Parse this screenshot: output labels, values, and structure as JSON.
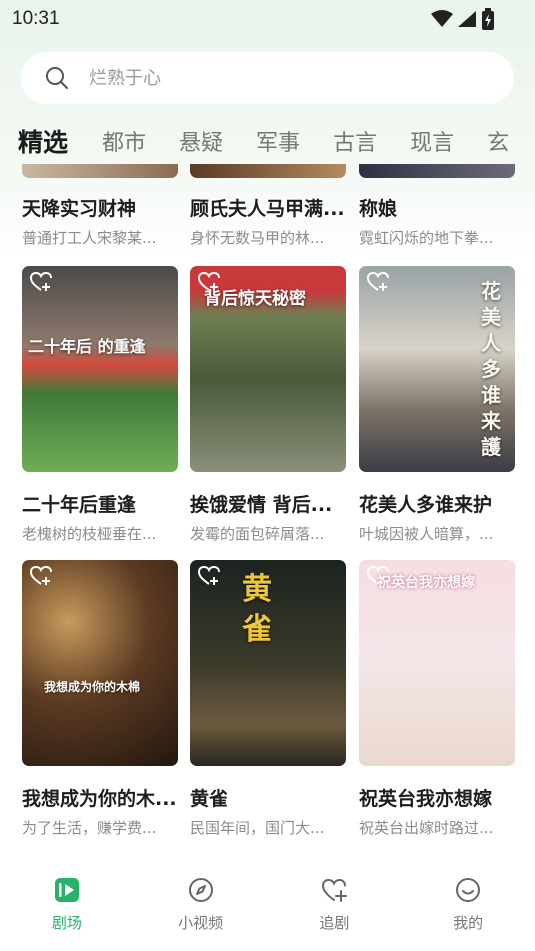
{
  "status": {
    "time": "10:31"
  },
  "search": {
    "placeholder": "烂熟于心"
  },
  "tabs": [
    {
      "label": "精选",
      "active": true
    },
    {
      "label": "都市"
    },
    {
      "label": "悬疑"
    },
    {
      "label": "军事"
    },
    {
      "label": "古言"
    },
    {
      "label": "现言"
    },
    {
      "label": "玄"
    }
  ],
  "dramas": [
    {
      "title": "天降实习财神",
      "desc": "普通打工人宋黎某..."
    },
    {
      "title": "顾氏夫人马甲满...",
      "desc": "身怀无数马甲的林..."
    },
    {
      "title": "称娘",
      "desc": "霓虹闪烁的地下拳..."
    },
    {
      "title": "二十年后重逢",
      "desc": "老槐树的枝桠垂在...",
      "poster_text": "二十年后 的重逢"
    },
    {
      "title": "挨饿爱情 背后...",
      "desc": "发霉的面包碎屑落...",
      "poster_text": "背后惊天秘密"
    },
    {
      "title": "花美人多谁来护",
      "desc": "叶城因被人暗算，...",
      "poster_text": "花美人多谁来護"
    },
    {
      "title": "我想成为你的木...",
      "desc": "为了生活，赚学费...",
      "poster_text": "我想成为你的木棉"
    },
    {
      "title": "黄雀",
      "desc": "民国年间，国门大...",
      "poster_text": "黄雀"
    },
    {
      "title": "祝英台我亦想嫁",
      "desc": "祝英台出嫁时路过...",
      "poster_text": "祝英台我亦想嫁"
    }
  ],
  "nav": [
    {
      "label": "剧场",
      "icon": "theater-play-icon",
      "active": true
    },
    {
      "label": "小视频",
      "icon": "compass-icon"
    },
    {
      "label": "追剧",
      "icon": "heart-plus-icon"
    },
    {
      "label": "我的",
      "icon": "smile-face-icon"
    }
  ],
  "colors": {
    "accent": "#27b26a",
    "background_top": "#e9f4ea"
  }
}
